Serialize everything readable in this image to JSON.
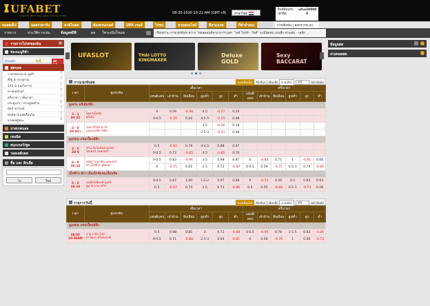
{
  "header": {
    "logo": "UFABET",
    "logo_tagline": "SPORTS BETTING AND LIVE CASINO",
    "datetime": "08-20-2020 10:21 AM (GMT+8)",
    "language": "ภาษาไทย",
    "account": {
      "welcome_label": "ยินดีต้อนรับ",
      "username": "ufsa30000",
      "credit_label": "เครดิต",
      "credit_value": "0",
      "bet_label": "การเดิมพัน",
      "bet_value": "0",
      "logout_label": "ออกจากระบบ"
    }
  },
  "nav_primary": [
    "บอลสเต็ป",
    "บอลราคาวัน",
    "คาสิโนสด",
    "ห้องสวนเกมส์",
    "UFA เกมส์",
    "ไก่ชน",
    "หวยออนไลน์",
    "ลีลาแบกต",
    "กีฬาจำลอง"
  ],
  "nav_secondary": [
    "รายการ",
    "ประวัติการเล่น",
    "ข้อมูลสถิติ",
    "ผล",
    "โทรเลนิงโหมด"
  ],
  "ticker": "เรียนท่าน การแข่งขันระหว่าง \"ฟอลคอนส์ลาฟ ยาร่าเนส - ไลส์ ไบรท์ - วิลลี่\" จะมีนัดชน เจนลีก-ฟาแต่บ - เอลีก ...",
  "banners": [
    "UFASLOT",
    "THAI LOTTO KINGMAKER",
    "Deluxe GOLD",
    "Sexy BACCARAT"
  ],
  "sidebar": {
    "my_bets": "รายการโปรดของฉัน",
    "sports_hd": "ช่องเมนูกีฬา",
    "tabs": [
      "ล่วงหน้า",
      "วันนี้",
      "สด 14"
    ],
    "football": "ฟุตบอล",
    "football_items": [
      {
        "label": "ราคาต่อรอง & สูงต่ำ",
        "count": "7"
      },
      {
        "label": "คี่/คู่ & ประตูรวม",
        "count": "7"
      },
      {
        "label": "1X2 & สองโอกาส",
        "count": "7"
      },
      {
        "label": "ทายผลสกอร์",
        "count": "7"
      },
      {
        "label": "ครึ่งเวลา / เต็มเวลา",
        "count": "7"
      },
      {
        "label": "ประตูแรก / ประตูสุดท้าย",
        "count": "6"
      },
      {
        "label": "มิกซ์ พาร์เลย์",
        "count": "7"
      },
      {
        "label": "มิกซ์พาร์เลย์คลื่อนไม",
        "count": "7"
      },
      {
        "label": "ทายผลผู้ชนะ",
        "count": "0"
      }
    ],
    "sports": [
      "บาสเกตบอล",
      "เทนนิส",
      "สนุกเกอร์/พูล",
      "วอลเลย์บอล"
    ],
    "search_hd": "ชื่อ และ ลีกเลีย",
    "search_go": "ไป",
    "search_reset": "ใหม่"
  },
  "right": {
    "info": "ข้อมูลสด",
    "live_odds": "ถ่ายทอดสด"
  },
  "live": {
    "title": "การแข่งขันสด",
    "btn_odds": "บอลเต็มเม็ด",
    "btn_league": "ลีกเลือก",
    "btn_select": "เลือกลีก",
    "btn_type": "ลายเดียว",
    "sort": "MY",
    "btn_page": "หน้าอันดับ",
    "columns": {
      "time": "เวลา",
      "match": "คู่แข่งขัน",
      "full": "เต็มเวลา",
      "half": "ครึ่งเวลา",
      "hdp": "แฮนดิแคป",
      "home": "เจ้าบ้าน",
      "away": "ทีมเยือน",
      "ou": "สูง/ต่ำ",
      "over": "สูง",
      "under": "ต่ำ"
    },
    "leagues": [
      {
        "name": "ยูเครน พรีเมียร์ลีก",
        "matches": [
          {
            "time": "3 - 1",
            "period": "2H 45",
            "home": "โคลาเม็คลัด",
            "away": "ศูรีเมีย",
            "rows": [
              [
                "0",
                "0.29",
                "-0.38",
                "4.5",
                "-0.27",
                "0.20",
                "",
                "",
                "",
                "",
                "",
                ""
              ],
              [
                "0-0.5",
                "-0.35",
                "0.26",
                "4.5-5",
                "-0.15",
                "0.08",
                "",
                "",
                "",
                "",
                "",
                ""
              ]
            ]
          },
          {
            "time": "2 - 0",
            "period": "2H 43+",
            "home": "โนอาร์โบ๊ท อาร์จ",
            "away": "เมลเบอร์ลีก มิชีเร",
            "rows": [
              [
                "",
                "",
                "",
                "3.5",
                "-0.26",
                "0.19",
                "",
                "",
                "",
                "",
                "",
                ""
              ],
              [
                "",
                "",
                "",
                "2.5-3",
                "-0.53",
                "0.48",
                "",
                "",
                "",
                "",
                "",
                ""
              ]
            ]
          }
        ]
      },
      {
        "name": "ยูเอฟเอ แชมเปี้ยนส์ลีก",
        "matches": [
          {
            "time": "3 - 0",
            "period": "2H 9",
            "home": "ซาน ยันโอปันย่ เมฆฟ",
            "away": "โซเฟอร์ เชฟเชอรี่",
            "rows": [
              [
                "0.5",
                "-0.92",
                "0.79",
                "4-4.5",
                "0.88",
                "0.97",
                "",
                "",
                "",
                "",
                "",
                ""
              ],
              [
                "0-0.5",
                "0.72",
                "-0.85",
                "4.5",
                "-0.85",
                "0.70",
                "",
                "",
                "",
                "",
                "",
                ""
              ]
            ]
          },
          {
            "time": "0 - 0",
            "period": "1H 14",
            "home": "เซลัล โบนาซัม เอลเดอร์",
            "away": "บีว เม็กซิโก ยูนิตเต",
            "rows": [
              [
                "0-0.5",
                "0.83",
                "-0.96",
                "3.5",
                "0.98",
                "0.87",
                "0",
                "-0.84",
                "0.71",
                "1",
                "-0.81",
                "0.66"
              ],
              [
                "0",
                "-0.75",
                "0.62",
                "2.5",
                "0.72",
                "-0.87",
                "0-0.5",
                "0.59",
                "-0.72",
                "0.5-1",
                "0.74",
                "-0.89"
              ]
            ]
          }
        ]
      },
      {
        "name": "เม็กซิโก ลีกา เอ็มเอ็กซ์แชมเปี้ยนชิพ",
        "matches": [
          {
            "time": "0 - 0",
            "period": "1H 14",
            "home": "เอเทียร์เพียนซ์ ยูเอที",
            "away": "ดูมาส ทาบาสโก",
            "rows": [
              [
                "0-0.5",
                "0.87",
                "1.00",
                "1.5-2",
                "0.97",
                "0.88",
                "0",
                "-0.71",
                "0.56",
                "0.5",
                "0.93",
                "0.93"
              ],
              [
                "0.5",
                "-0.87",
                "0.74",
                "1.5",
                "0.71",
                "-0.86",
                "0.5",
                "0.55",
                "-0.68",
                "0.5-1",
                "-0.73",
                "0.58"
              ]
            ]
          }
        ]
      }
    ]
  },
  "today": {
    "title": "รายการวันนี้",
    "btn_odds": "บอลเต็มเม็ด",
    "btn_league": "ลีกเลือก",
    "btn_select": "เลือกลีก",
    "btn_type": "ลายเดียว",
    "sort": "MY",
    "btn_page": "หน้าอันดับ",
    "leagues": [
      {
        "name": "ยูเอฟเอ แชมเปี้ยนส์ลีก",
        "matches": [
          {
            "time": "08/20",
            "period": "10:30AM",
            "home": "ลาส เวกัส ไลท์",
            "away": "ทาโคมา ดีไฟแอนซ์",
            "rows": [
              [
                "0.5",
                "0.98",
                "0.85",
                "3",
                "0.71",
                "-0.88",
                "0-0.5",
                "-0.95",
                "0.78",
                "1-1.5",
                "0.83",
                "-1.00"
              ],
              [
                "0-0.5",
                "0.71",
                "-0.88",
                "2.5-3",
                "0.64",
                "-0.81",
                "0",
                "0.56",
                "-0.76",
                "1",
                "0.56",
                "-0.73"
              ]
            ]
          }
        ]
      }
    ]
  }
}
